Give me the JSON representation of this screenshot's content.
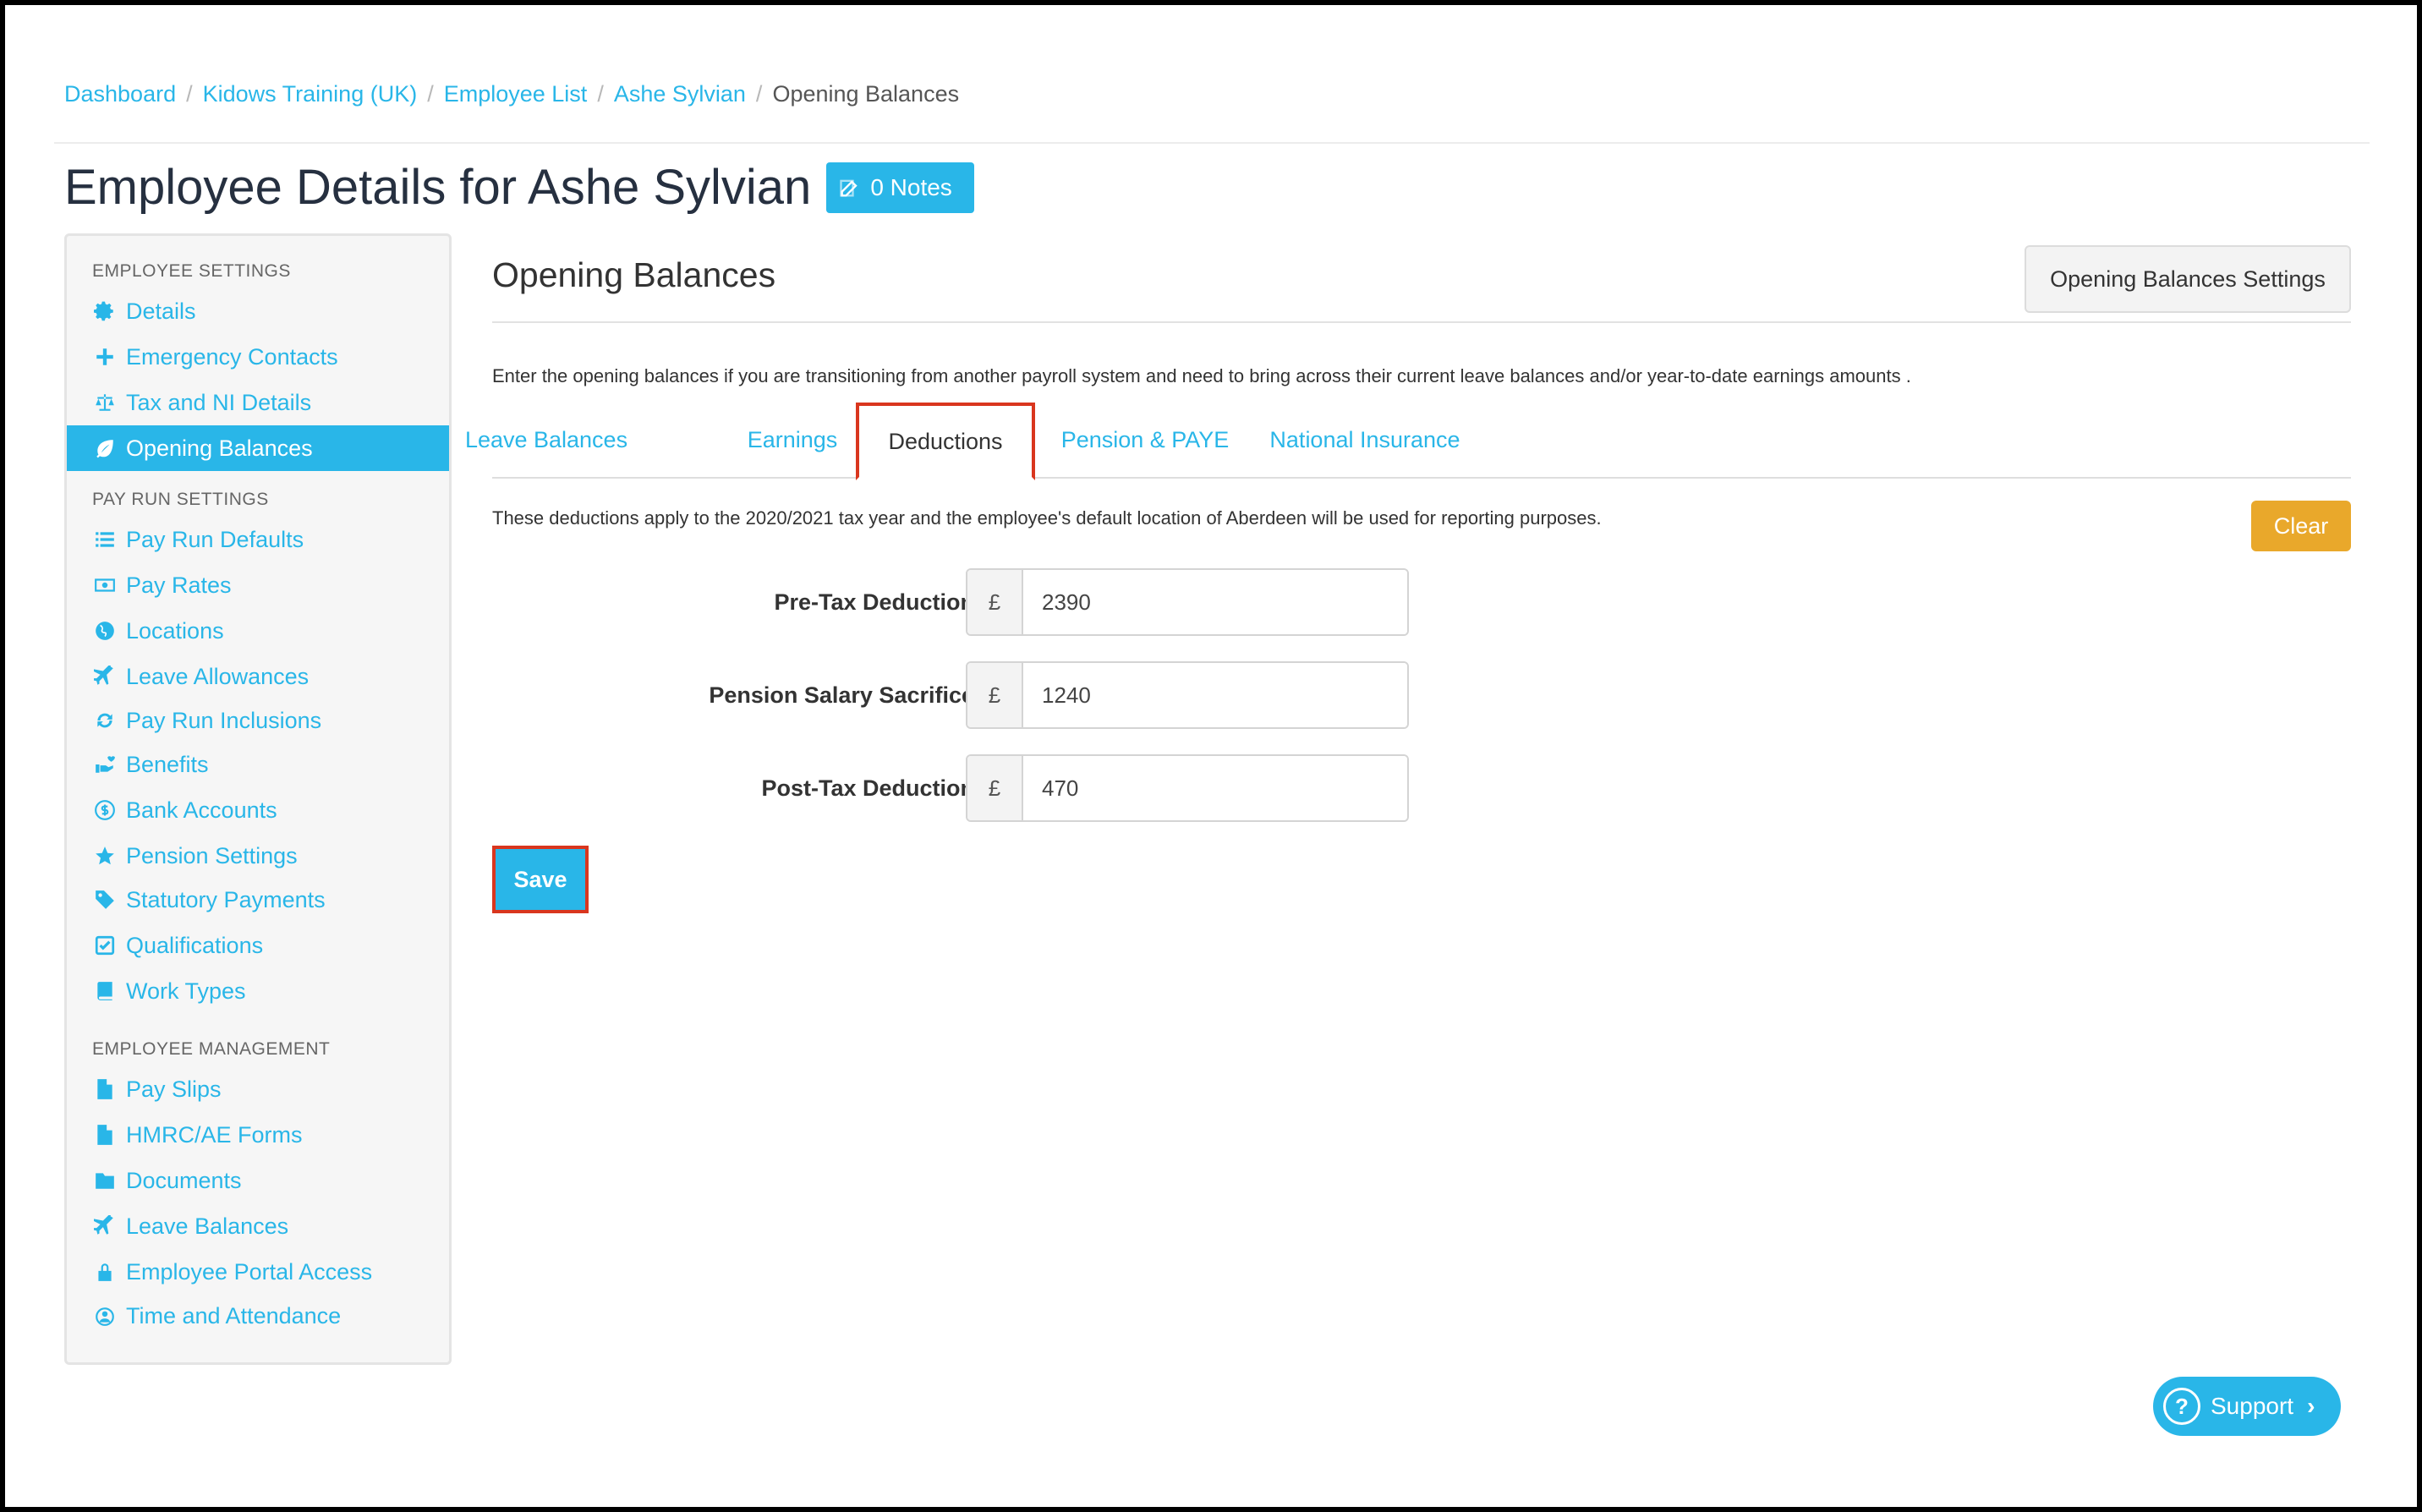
{
  "breadcrumb": {
    "items": [
      "Dashboard",
      "Kidows Training (UK)",
      "Employee List",
      "Ashe Sylvian"
    ],
    "current": "Opening Balances",
    "separator": "/"
  },
  "page": {
    "title": "Employee Details for Ashe Sylvian",
    "notes_label": "0 Notes"
  },
  "sidebar": {
    "headings": [
      "EMPLOYEE SETTINGS",
      "PAY RUN SETTINGS",
      "EMPLOYEE MANAGEMENT"
    ],
    "items": [
      {
        "label": "Details",
        "icon": "gear-icon"
      },
      {
        "label": "Emergency Contacts",
        "icon": "plus-icon"
      },
      {
        "label": "Tax and NI Details",
        "icon": "scale-icon"
      },
      {
        "label": "Opening Balances",
        "icon": "leaf-icon",
        "active": true
      },
      {
        "label": "Pay Run Defaults",
        "icon": "list-icon"
      },
      {
        "label": "Pay Rates",
        "icon": "money-icon"
      },
      {
        "label": "Locations",
        "icon": "globe-icon"
      },
      {
        "label": "Leave Allowances",
        "icon": "plane-icon"
      },
      {
        "label": "Pay Run Inclusions",
        "icon": "refresh-icon"
      },
      {
        "label": "Benefits",
        "icon": "benefits-icon"
      },
      {
        "label": "Bank Accounts",
        "icon": "dollar-circle-icon"
      },
      {
        "label": "Pension Settings",
        "icon": "star-icon"
      },
      {
        "label": "Statutory Payments",
        "icon": "tag-icon"
      },
      {
        "label": "Qualifications",
        "icon": "check-square-icon"
      },
      {
        "label": "Work Types",
        "icon": "book-icon"
      },
      {
        "label": "Pay Slips",
        "icon": "file-icon"
      },
      {
        "label": "HMRC/AE Forms",
        "icon": "file-icon"
      },
      {
        "label": "Documents",
        "icon": "folder-icon"
      },
      {
        "label": "Leave Balances",
        "icon": "plane-icon"
      },
      {
        "label": "Employee Portal Access",
        "icon": "lock-icon"
      },
      {
        "label": "Time and Attendance",
        "icon": "user-clock-icon"
      }
    ]
  },
  "main": {
    "title": "Opening Balances",
    "settings_button": "Opening Balances Settings",
    "intro": "Enter the opening balances if you are transitioning from another payroll system and need to bring across their current leave balances and/or year-to-date earnings amounts .",
    "tabs": [
      {
        "label": "Leave Balances"
      },
      {
        "label": "Earnings"
      },
      {
        "label": "Deductions",
        "active": true
      },
      {
        "label": "Pension & PAYE"
      },
      {
        "label": "National Insurance"
      }
    ],
    "info": "These deductions apply to the 2020/2021 tax year and the employee's default location of Aberdeen will be used for reporting purposes.",
    "clear_label": "Clear",
    "currency_symbol": "£",
    "fields": [
      {
        "label": "Pre-Tax Deduction",
        "value": "2390"
      },
      {
        "label": "Pension Salary Sacrifice",
        "value": "1240"
      },
      {
        "label": "Post-Tax Deduction",
        "value": "470"
      }
    ],
    "save_label": "Save"
  },
  "support": {
    "label": "Support",
    "icon": "question-circle-icon"
  },
  "colors": {
    "accent": "#29b6e8",
    "warning": "#e9a82b",
    "highlight": "#d9361e"
  }
}
